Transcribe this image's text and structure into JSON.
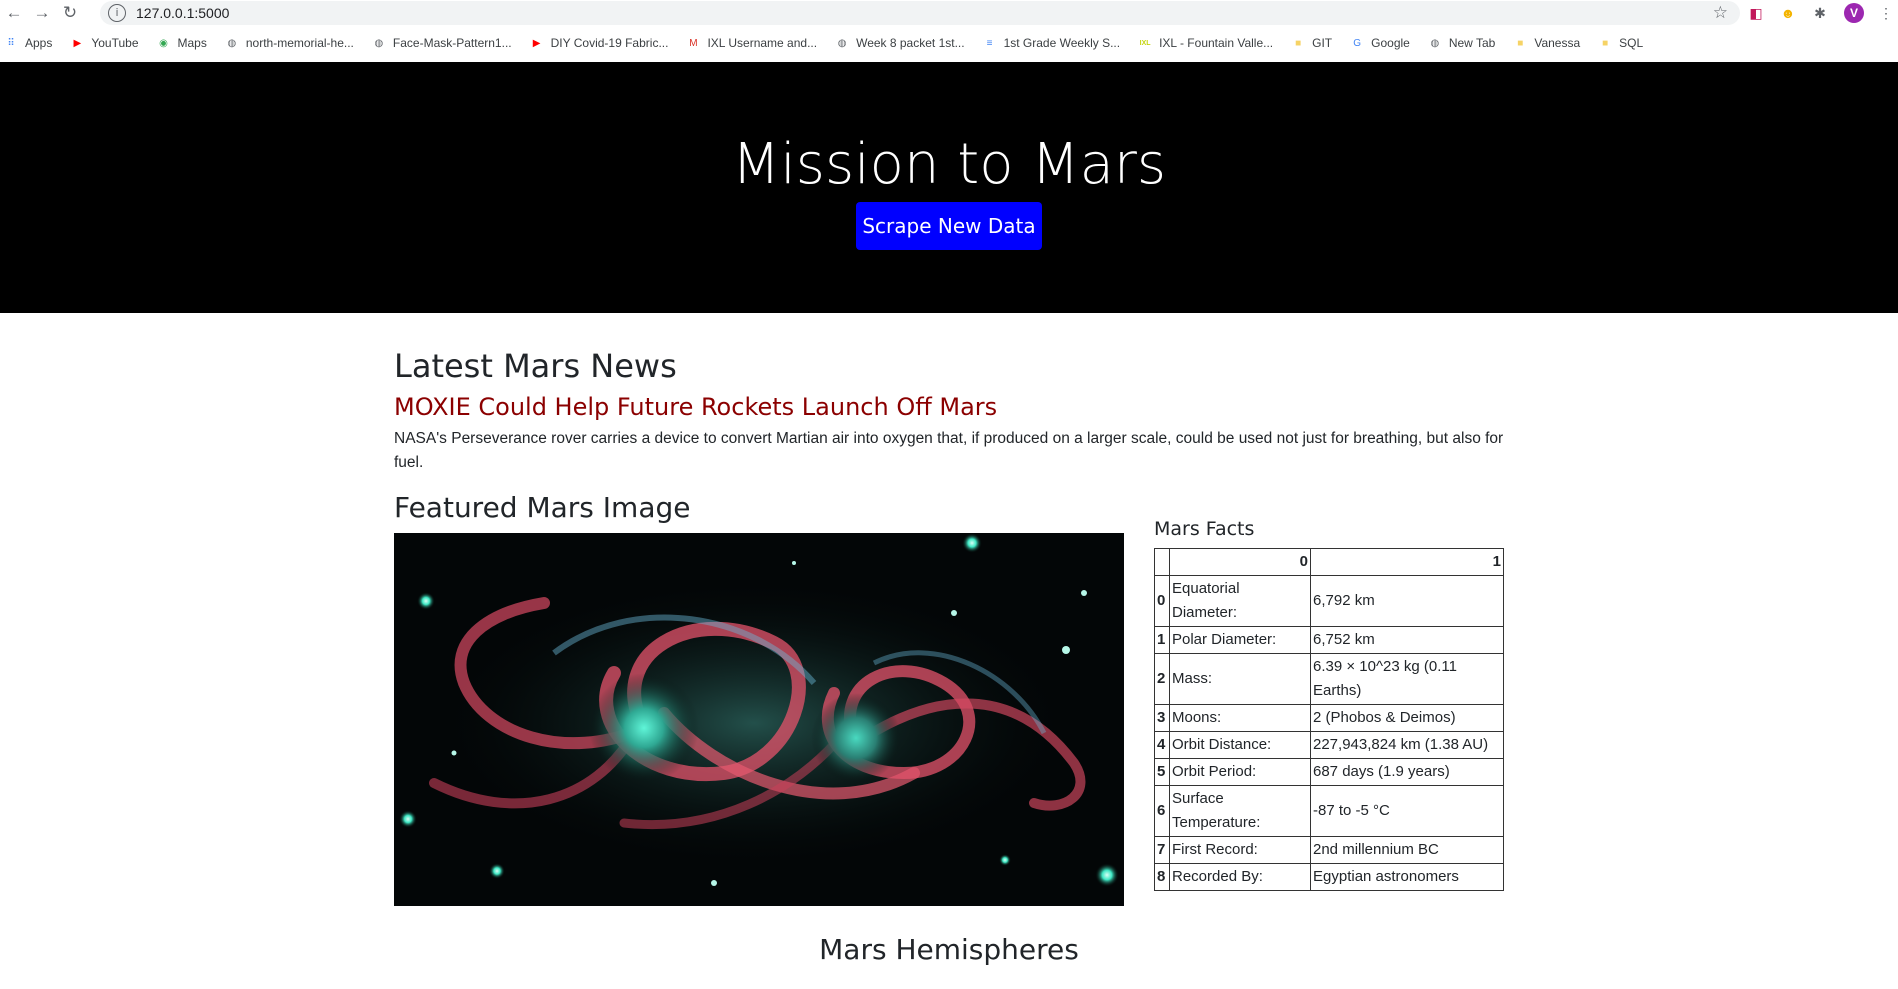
{
  "browser": {
    "url": "127.0.0.1:5000",
    "profile_initial": "V",
    "bookmarks": [
      {
        "label": "Apps",
        "icon": "apps-grid-icon",
        "color": "#4285f4"
      },
      {
        "label": "YouTube",
        "icon": "youtube-icon",
        "color": "#ff0000"
      },
      {
        "label": "Maps",
        "icon": "maps-pin-icon",
        "color": "#34a853"
      },
      {
        "label": "north-memorial-he...",
        "icon": "globe-icon",
        "color": "#5f6368"
      },
      {
        "label": "Face-Mask-Pattern1...",
        "icon": "globe-icon",
        "color": "#5f6368"
      },
      {
        "label": "DIY Covid-19 Fabric...",
        "icon": "youtube-icon",
        "color": "#ff0000"
      },
      {
        "label": "IXL Username and...",
        "icon": "gmail-icon",
        "color": "#d93025"
      },
      {
        "label": "Week 8 packet 1st...",
        "icon": "globe-icon",
        "color": "#5f6368"
      },
      {
        "label": "1st Grade Weekly S...",
        "icon": "docs-icon",
        "color": "#4285f4"
      },
      {
        "label": "IXL - Fountain Valle...",
        "icon": "ixl-icon",
        "color": "#c5d40f"
      },
      {
        "label": "GIT",
        "icon": "folder-icon",
        "color": "#f6d365"
      },
      {
        "label": "Google",
        "icon": "google-icon",
        "color": "#4285f4"
      },
      {
        "label": "New Tab",
        "icon": "globe-icon",
        "color": "#5f6368"
      },
      {
        "label": "Vanessa",
        "icon": "folder-icon",
        "color": "#f6d365"
      },
      {
        "label": "SQL",
        "icon": "folder-icon",
        "color": "#f6d365"
      }
    ]
  },
  "page": {
    "title": "Mission to Mars",
    "scrape_button": "Scrape New Data",
    "news": {
      "heading": "Latest Mars News",
      "title": "MOXIE Could Help Future Rockets Launch Off Mars",
      "paragraph": "NASA's Perseverance rover carries a device to convert Martian air into oxygen that, if produced on a larger scale, could be used not just for breathing, but also for fuel."
    },
    "featured": {
      "heading": "Featured Mars Image"
    },
    "facts": {
      "heading": "Mars Facts",
      "columns": [
        "",
        "0",
        "1"
      ],
      "rows": [
        {
          "idx": "0",
          "key": "Equatorial Diameter:",
          "val": "6,792 km"
        },
        {
          "idx": "1",
          "key": "Polar Diameter:",
          "val": "6,752 km"
        },
        {
          "idx": "2",
          "key": "Mass:",
          "val": "6.39 × 10^23 kg (0.11 Earths)"
        },
        {
          "idx": "3",
          "key": "Moons:",
          "val": "2 (Phobos & Deimos)"
        },
        {
          "idx": "4",
          "key": "Orbit Distance:",
          "val": "227,943,824 km (1.38 AU)"
        },
        {
          "idx": "5",
          "key": "Orbit Period:",
          "val": "687 days (1.9 years)"
        },
        {
          "idx": "6",
          "key": "Surface Temperature:",
          "val": "-87 to -5 °C"
        },
        {
          "idx": "7",
          "key": "First Record:",
          "val": "2nd millennium BC"
        },
        {
          "idx": "8",
          "key": "Recorded By:",
          "val": "Egyptian astronomers"
        }
      ]
    },
    "hemispheres": {
      "heading": "Mars Hemispheres"
    }
  },
  "colors": {
    "jumbotron_bg": "#000000",
    "button_bg": "#0000ff",
    "news_title": "#8b0000"
  }
}
